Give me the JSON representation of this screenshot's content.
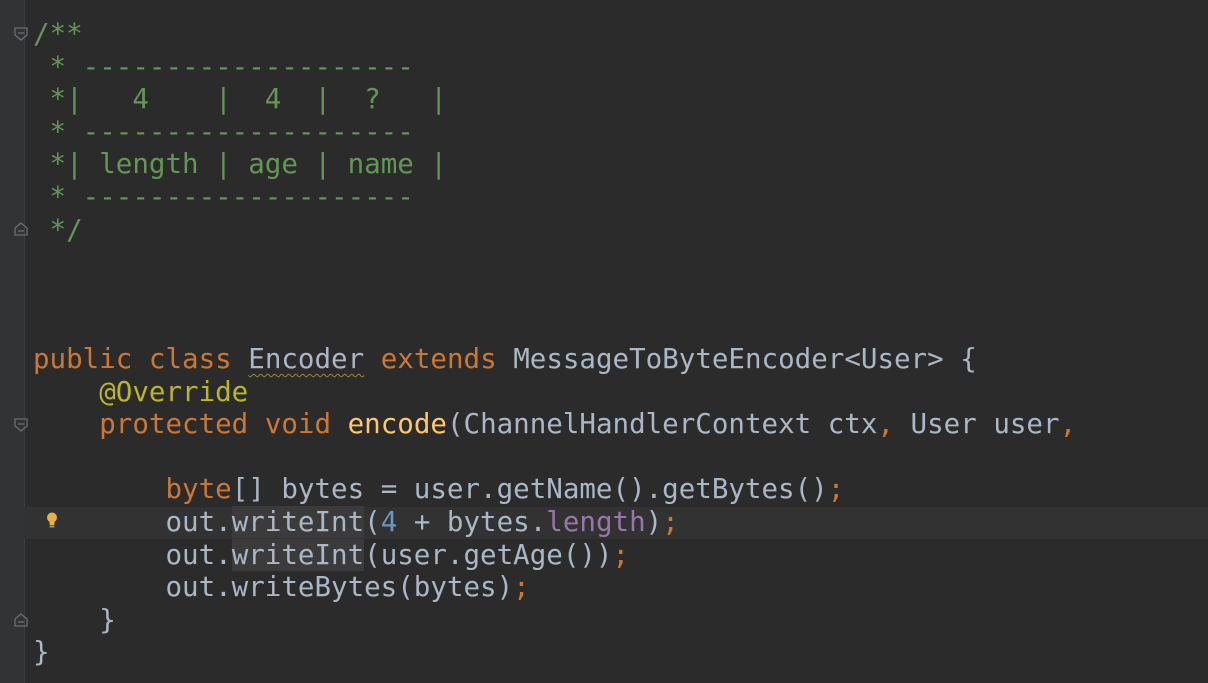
{
  "editor": {
    "comment": {
      "open": "/**",
      "rule1": " * --------------------",
      "row1_star": " *",
      "row1_cells": "|   4    |  4  |  ?   |",
      "rule2": " * --------------------",
      "row2_star": " *",
      "row2_cells": "| length | age | name |",
      "rule3": " * --------------------",
      "close": " */"
    },
    "code": {
      "kw_public": "public",
      "kw_class": "class",
      "class_name": "Encoder",
      "kw_extends": "extends",
      "superclass": "MessageToByteEncoder<User>",
      "open_brace": " {",
      "annotation": "@Override",
      "kw_protected": "protected",
      "kw_void": "void",
      "method_name": "encode",
      "params": "(ChannelHandlerContext ctx",
      "comma1": ",",
      "params2": " User user",
      "comma2": ",",
      "kw_byte": "byte",
      "line_bytes": "[] bytes = user.getName().getBytes()",
      "semi": ";",
      "out1": "out.",
      "write_int": "writeInt",
      "paren_open": "(",
      "num_four": "4",
      "plus_bytes": " + bytes.",
      "field_length": "length",
      "paren_close": ")",
      "out2": "out.",
      "write_int2": "writeInt",
      "call_age": "(user.getAge())",
      "out3": "out.writeBytes(bytes)",
      "method_close": "}",
      "class_close": "}"
    }
  },
  "colors": {
    "background": "#2b2b2b",
    "gutter": "#313335",
    "comment": "#629755",
    "keyword": "#cc7832",
    "annotation": "#bbb529",
    "method_declaration": "#ffc66d",
    "number": "#6897bb",
    "field": "#9876aa",
    "plain_text": "#a9b7c6"
  },
  "icons": [
    "fold-marker-icon",
    "lightbulb-icon"
  ]
}
